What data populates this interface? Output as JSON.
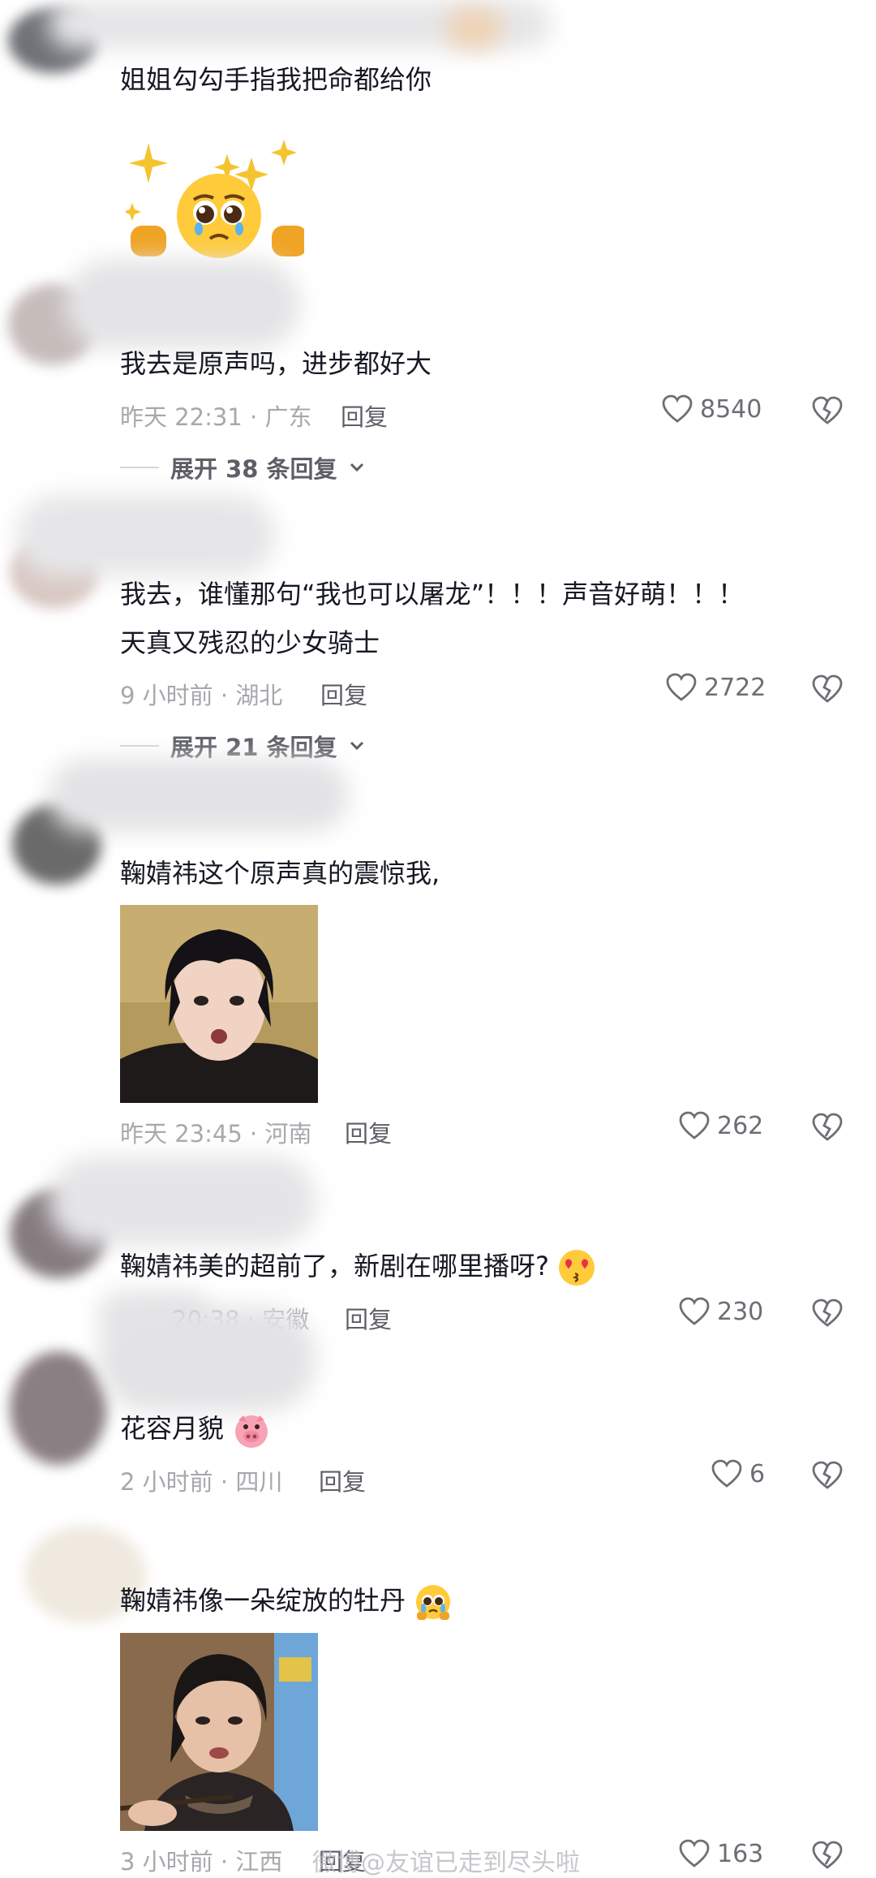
{
  "comments": [
    {
      "text": "姐姐勾勾手指我把命都给你",
      "sticker": "pleading-face-sticker"
    },
    {
      "text": "我去是原声吗，进步都好大",
      "meta": "昨天 22:31 · 广东",
      "reply_label": "回复",
      "likes": "8540",
      "expand_label": "展开 38 条回复"
    },
    {
      "text_line1": "我去，谁懂那句“我也可以屠龙”！！！声音好萌！！！",
      "text_line2": "天真又残忍的少女骑士",
      "meta": "9 小时前 · 湖北",
      "reply_label": "回复",
      "likes": "2722",
      "expand_label": "展开 21 条回复"
    },
    {
      "text": "鞠婧祎这个原声真的震惊我,",
      "image": "portrait-photo",
      "meta": "昨天 23:45 · 河南",
      "reply_label": "回复",
      "likes": "262"
    },
    {
      "text": "鞠婧祎美的超前了，新剧在哪里播呀?",
      "emoji": "heart-eyes-kiss-emoji",
      "meta": "20:38 · 安徽",
      "reply_label": "回复",
      "likes": "230"
    },
    {
      "text": "花容月貌",
      "emoji": "pig-face-emoji",
      "meta": "2 小时前 · 四川",
      "reply_label": "回复",
      "likes": "6"
    },
    {
      "text": "鞠婧祎像一朵绽放的牡丹",
      "emoji": "crying-face-emoji",
      "image": "woman-eating-photo",
      "meta": "3 小时前 · 江西",
      "reply_label": "回复",
      "likes": "163"
    }
  ],
  "watermark": "微博@友谊已走到尽头啦",
  "colors": {
    "text": "#161823",
    "meta": "#a7a8ad",
    "reply": "#5d5e66",
    "divider": "#d6d6da"
  }
}
